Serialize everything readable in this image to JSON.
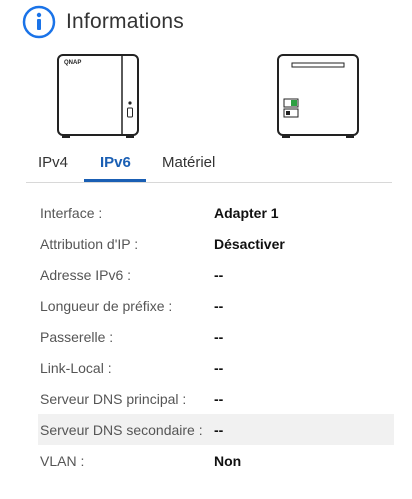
{
  "header": {
    "title": "Informations",
    "icon": "info-icon",
    "icon_color": "#1a73e8"
  },
  "device": {
    "front_brand": "QNAP",
    "front_icon": "nas-front-icon",
    "back_icon": "nas-back-icon",
    "port_color": "#2ea043"
  },
  "tabs": [
    {
      "label": "IPv4",
      "active": false
    },
    {
      "label": "IPv6",
      "active": true
    },
    {
      "label": "Matériel",
      "active": false
    }
  ],
  "accent_color": "#1a5fb4",
  "rows": [
    {
      "label": "Interface :",
      "value": "Adapter 1"
    },
    {
      "label": "Attribution d'IP :",
      "value": "Désactiver"
    },
    {
      "label": "Adresse IPv6  :",
      "value": "--"
    },
    {
      "label": "Longueur de préfixe :",
      "value": "--"
    },
    {
      "label": "Passerelle :",
      "value": "--"
    },
    {
      "label": "Link-Local :",
      "value": "--"
    },
    {
      "label": "Serveur DNS principal :",
      "value": "--"
    },
    {
      "label": "Serveur DNS secondaire :",
      "value": "--"
    },
    {
      "label": "VLAN :",
      "value": "Non"
    }
  ]
}
